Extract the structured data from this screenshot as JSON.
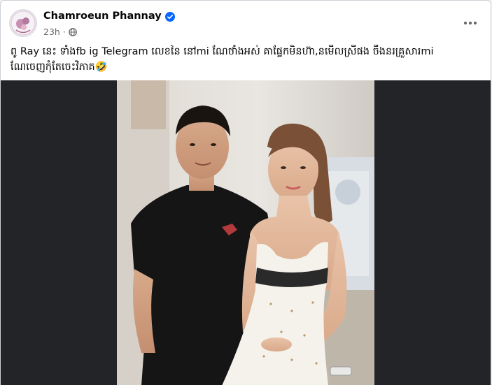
{
  "post": {
    "author": "Chamroeun Phannay",
    "time": "23h",
    "separator": "·",
    "caption_line1": "ពូ Ray នេះ ទាំងfb ig Telegram លេខនៃ នៅmi ណែថាំងអស់ គាផ្ទែកមិនហ៊ា,នមើលស្រីផង ចឹងនរគ្រួសារmi",
    "caption_line2": "ណែចេញកុំតែចេះវិភាគ🤣"
  },
  "icons": {
    "verified": "verified-badge-icon",
    "audience": "globe-icon",
    "more": "more-options-icon"
  },
  "colors": {
    "verified_blue": "#0866ff",
    "text_primary": "#050505",
    "text_secondary": "#65676b",
    "media_background": "#222428"
  }
}
